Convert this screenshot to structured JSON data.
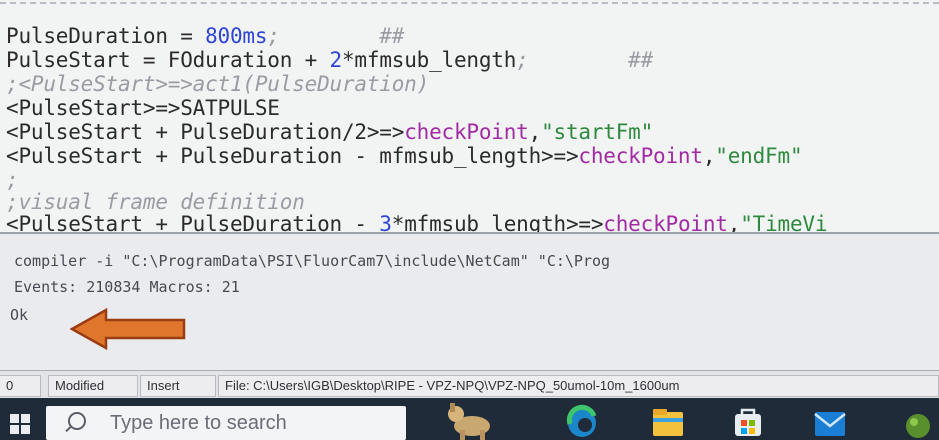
{
  "editor": {
    "lines": [
      {
        "segments": [
          {
            "t": "PulseDuration = ",
            "c": "c-kw"
          },
          {
            "t": "800ms",
            "c": "c-num"
          },
          {
            "t": ";        ##",
            "c": "c-com"
          }
        ]
      },
      {
        "segments": [
          {
            "t": "PulseStart = FOduration + ",
            "c": "c-kw"
          },
          {
            "t": "2",
            "c": "c-num"
          },
          {
            "t": "*mfmsub_length",
            "c": "c-kw"
          },
          {
            "t": ";        ##",
            "c": "c-com"
          }
        ]
      },
      {
        "segments": [
          {
            "t": ";<PulseStart>=>act1(PulseDuration)",
            "c": "c-com"
          }
        ]
      },
      {
        "segments": [
          {
            "t": "<PulseStart>=>SATPULSE",
            "c": "c-kw"
          }
        ]
      },
      {
        "segments": [
          {
            "t": "<PulseStart + PulseDuration/2>=>",
            "c": "c-kw"
          },
          {
            "t": "checkPoint",
            "c": "c-mag"
          },
          {
            "t": ",",
            "c": "c-kw"
          },
          {
            "t": "\"startFm\"",
            "c": "c-str"
          }
        ]
      },
      {
        "segments": [
          {
            "t": "<PulseStart + PulseDuration - mfmsub_length>=>",
            "c": "c-kw"
          },
          {
            "t": "checkPoint",
            "c": "c-mag"
          },
          {
            "t": ",",
            "c": "c-kw"
          },
          {
            "t": "\"endFm\"",
            "c": "c-str"
          }
        ]
      },
      {
        "segments": [
          {
            "t": ";",
            "c": "c-com"
          }
        ]
      },
      {
        "segments": [
          {
            "t": ";visual frame definition",
            "c": "c-com"
          }
        ]
      },
      {
        "segments": [
          {
            "t": "<PulseStart + PulseDuration - ",
            "c": "c-kw"
          },
          {
            "t": "3",
            "c": "c-num"
          },
          {
            "t": "*mfmsub_length>=>",
            "c": "c-kw"
          },
          {
            "t": "checkPoint",
            "c": "c-mag"
          },
          {
            "t": ",",
            "c": "c-kw"
          },
          {
            "t": "\"TimeVi",
            "c": "c-str"
          }
        ]
      }
    ]
  },
  "output": {
    "command": "compiler -i \"C:\\ProgramData\\PSI\\FluorCam7\\include\\NetCam\" \"C:\\Prog",
    "events": "Events: 210834 Macros: 21",
    "status": "Ok"
  },
  "statusbar": {
    "position": "0",
    "modified": "Modified",
    "insert": "Insert",
    "file": "File: C:\\Users\\IGB\\Desktop\\RIPE - VPZ-NPQ\\VPZ-NPQ_50umol-10m_1600um"
  },
  "taskbar": {
    "search_placeholder": "Type here to search",
    "icons": [
      "windows-start-icon",
      "search-icon",
      "cortana-dog-icon",
      "edge-browser-icon",
      "file-explorer-icon",
      "store-icon",
      "mail-icon",
      "app-icon"
    ]
  },
  "colors": {
    "number": "#2d44d6",
    "keyword_magenta": "#a22aa5",
    "string_green": "#2d8a3e",
    "comment": "#9a9ca3",
    "arrow": "#e0762c",
    "taskbar": "#1f2b38"
  }
}
